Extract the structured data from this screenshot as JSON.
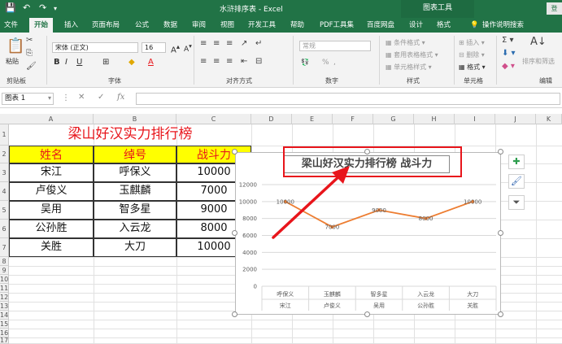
{
  "titlebar": {
    "doc_title": "水浒排序表 - Excel",
    "context_tools": "图表工具",
    "login": "登"
  },
  "tabs": [
    "文件",
    "开始",
    "插入",
    "页面布局",
    "公式",
    "数据",
    "审阅",
    "视图",
    "开发工具",
    "帮助",
    "PDF工具集",
    "百度网盘",
    "设计",
    "格式",
    "操作说明搜索"
  ],
  "active_tab": "开始",
  "ribbon": {
    "paste": "粘贴",
    "clipboard": "剪贴板",
    "font_name": "宋体 (正文)",
    "font_size": "16",
    "font_group": "字体",
    "align_group": "对齐方式",
    "number_format": "常规",
    "number_group": "数字",
    "cond_format": "条件格式",
    "table_format": "套用表格格式",
    "cell_style": "单元格样式",
    "styles_group": "样式",
    "insert": "插入",
    "delete": "删除",
    "format": "格式",
    "cells_group": "单元格",
    "sort_filter": "排序和筛选",
    "edit_group": "编辑",
    "percent": "%",
    "comma": ","
  },
  "formula_bar": {
    "name_box": "图表 1",
    "fx": "fx"
  },
  "columns": [
    "A",
    "B",
    "C",
    "D",
    "E",
    "F",
    "G",
    "H",
    "I",
    "J",
    "K"
  ],
  "rows": [
    "1",
    "2",
    "3",
    "4",
    "5",
    "6",
    "7",
    "8",
    "9",
    "10",
    "11",
    "12",
    "13",
    "14",
    "15",
    "16",
    "17",
    "18",
    "19"
  ],
  "sheet": {
    "title": "梁山好汉实力排行榜",
    "headers": [
      "姓名",
      "绰号",
      "战斗力"
    ],
    "data": [
      [
        "宋江",
        "呼保义",
        "10000"
      ],
      [
        "卢俊义",
        "玉麒麟",
        "7000"
      ],
      [
        "吴用",
        "智多星",
        "9000"
      ],
      [
        "公孙胜",
        "入云龙",
        "8000"
      ],
      [
        "关胜",
        "大刀",
        "10000"
      ]
    ]
  },
  "chart_data": {
    "type": "line",
    "title": "梁山好汉实力排行榜 战斗力",
    "categories": [
      [
        "呼保义",
        "宋江"
      ],
      [
        "玉麒麟",
        "卢俊义"
      ],
      [
        "智多星",
        "吴用"
      ],
      [
        "入云龙",
        "公孙胜"
      ],
      [
        "大刀",
        "关胜"
      ]
    ],
    "series": [
      {
        "values": [
          10000,
          7000,
          9000,
          8000,
          10000
        ]
      }
    ],
    "data_labels": [
      "10000",
      "7000",
      "9000",
      "8000",
      "10000"
    ],
    "ylim": [
      0,
      12000
    ],
    "yticks": [
      0,
      2000,
      4000,
      6000,
      8000,
      10000,
      12000
    ],
    "line_color": "#ed7d31",
    "grid": true
  },
  "colors": {
    "excel_green": "#217346",
    "title_red": "#e8151b",
    "header_yellow": "#ffff00"
  }
}
